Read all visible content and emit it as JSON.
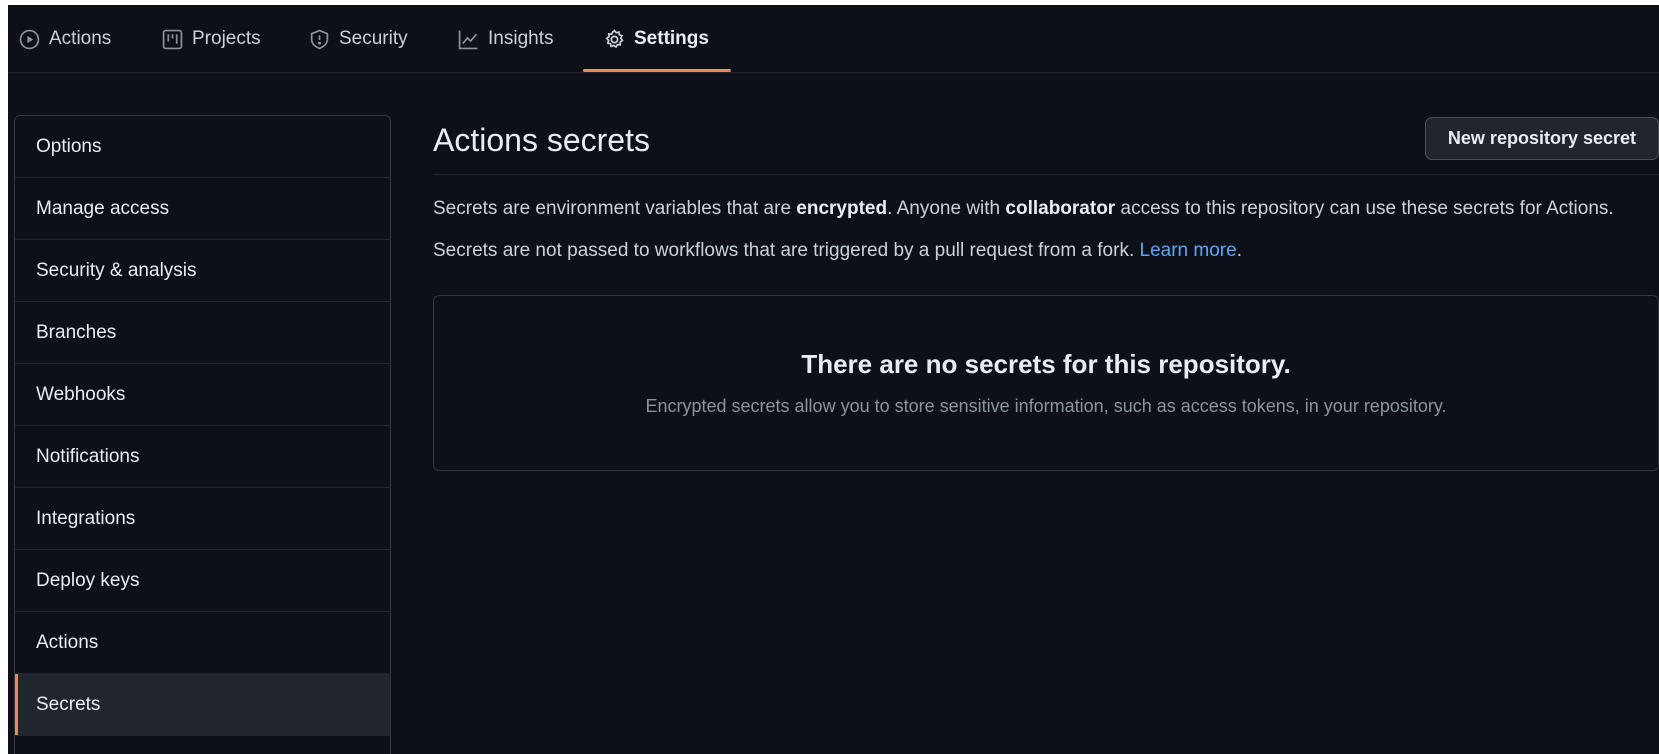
{
  "nav": {
    "tabs": [
      {
        "label": "Actions",
        "icon": "play-circle-icon"
      },
      {
        "label": "Projects",
        "icon": "project-board-icon"
      },
      {
        "label": "Security",
        "icon": "shield-icon"
      },
      {
        "label": "Insights",
        "icon": "graph-icon"
      },
      {
        "label": "Settings",
        "icon": "gear-icon",
        "active": true
      }
    ]
  },
  "sidebar": {
    "items": [
      {
        "label": "Options"
      },
      {
        "label": "Manage access"
      },
      {
        "label": "Security & analysis"
      },
      {
        "label": "Branches"
      },
      {
        "label": "Webhooks"
      },
      {
        "label": "Notifications"
      },
      {
        "label": "Integrations"
      },
      {
        "label": "Deploy keys"
      },
      {
        "label": "Actions"
      },
      {
        "label": "Secrets",
        "selected": true
      }
    ]
  },
  "main": {
    "title": "Actions secrets",
    "new_button": "New repository secret",
    "description": {
      "part1": "Secrets are environment variables that are ",
      "bold1": "encrypted",
      "part2": ". Anyone with ",
      "bold2": "collaborator",
      "part3": " access to this repository can use these secrets for Actions."
    },
    "fork_note": {
      "text": "Secrets are not passed to workflows that are triggered by a pull request from a fork. ",
      "link": "Learn more",
      "end": "."
    },
    "empty_state": {
      "title": "There are no secrets for this repository.",
      "description": "Encrypted secrets allow you to store sensitive information, such as access tokens, in your repository."
    }
  },
  "colors": {
    "background": "#0d1117",
    "accent": "#f78166",
    "link": "#58a6ff"
  }
}
